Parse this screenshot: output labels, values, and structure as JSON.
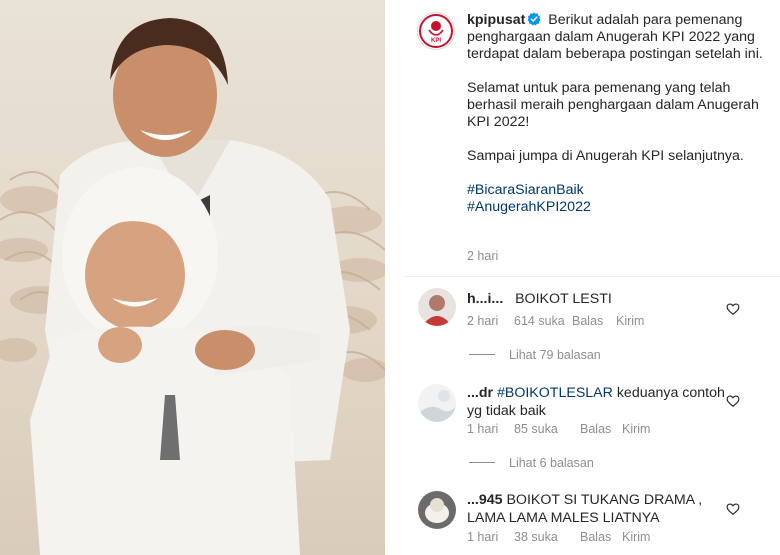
{
  "post": {
    "username": "kpipusat",
    "caption_paragraphs": [
      "Berikut adalah para pemenang penghargaan dalam Anugerah KPI 2022 yang terdapat dalam beberapa postingan setelah ini.",
      "Selamat untuk para pemenang yang telah berhasil meraih penghargaan dalam Anugerah KPI 2022!",
      "Sampai jumpa di Anugerah KPI selanjutnya."
    ],
    "hashtags": [
      "#BicaraSiaranBaik",
      "#AnugerahKPI2022"
    ],
    "time": "2 hari",
    "logo_text": "KPI"
  },
  "comments": [
    {
      "username": "h...i...",
      "text": "BOIKOT LESTI",
      "hashtag": "",
      "time": "2 hari",
      "likes": "614 suka",
      "reply_label": "Balas",
      "send_label": "Kirim",
      "view_replies": "Lihat 79 balasan"
    },
    {
      "username": "...dr",
      "hashtag": "#BOIKOTLESLAR",
      "text": " keduanya contoh yg tidak baik",
      "time": "1 hari",
      "likes": "85 suka",
      "reply_label": "Balas",
      "send_label": "Kirim",
      "view_replies": "Lihat 6 balasan"
    },
    {
      "username": "...945",
      "text": "BOIKOT SI TUKANG DRAMA , LAMA LAMA MALES LIATNYA",
      "hashtag": "",
      "time": "1 hari",
      "likes": "38 suka",
      "reply_label": "Balas",
      "send_label": "Kirim",
      "view_replies": ""
    }
  ],
  "colors": {
    "text": "#262626",
    "muted": "#8e8e8e",
    "link": "#00376b",
    "verified": "#0095f6",
    "logo_red": "#c8102e"
  },
  "icons": [
    "verified-badge-icon",
    "heart-icon",
    "kpi-logo"
  ]
}
